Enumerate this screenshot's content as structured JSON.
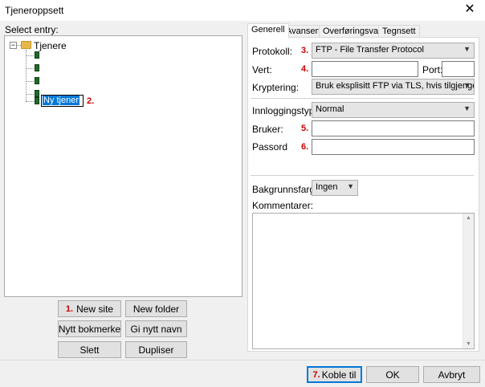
{
  "window": {
    "title": "Tjeneroppsett",
    "close_icon": "close-icon"
  },
  "left": {
    "select_entry_label": "Select entry:",
    "tree": {
      "root_label": "Tjenere",
      "new_item_label": "Ny tjener",
      "new_item_step": "2."
    },
    "buttons": {
      "new_site": "New site",
      "new_site_step": "1.",
      "new_folder": "New folder",
      "new_bookmark": "Nytt bokmerke",
      "rename": "Gi nytt navn",
      "delete": "Slett",
      "duplicate": "Dupliser"
    }
  },
  "tabs": [
    {
      "label": "Generell",
      "active": true
    },
    {
      "label": "Avansert",
      "active": false
    },
    {
      "label": "Overføringsvalg",
      "active": false
    },
    {
      "label": "Tegnsett",
      "active": false
    }
  ],
  "general": {
    "protocol_label": "Protokoll:",
    "protocol_step": "3.",
    "protocol_value": "FTP - File Transfer Protocol",
    "host_label": "Vert:",
    "host_step": "4.",
    "host_value": "",
    "port_label": "Port:",
    "port_value": "",
    "encryption_label": "Kryptering:",
    "encryption_value": "Bruk eksplisitt FTP via TLS, hvis tilgjengelig",
    "logon_type_label": "Innloggingstype:",
    "logon_type_value": "Normal",
    "user_label": "Bruker:",
    "user_step": "5.",
    "user_value": "",
    "password_label": "Passord",
    "password_step": "6.",
    "password_value": "",
    "background_label": "Bakgrunnsfarge:",
    "background_value": "Ingen",
    "comments_label": "Kommentarer:"
  },
  "footer": {
    "connect_step": "7.",
    "connect_label": "Koble til",
    "ok_label": "OK",
    "cancel_label": "Avbryt"
  },
  "colors": {
    "accent": "#0078d7",
    "step": "#cc0000",
    "folder": "#e8b84a",
    "server": "#1f6b2a"
  }
}
